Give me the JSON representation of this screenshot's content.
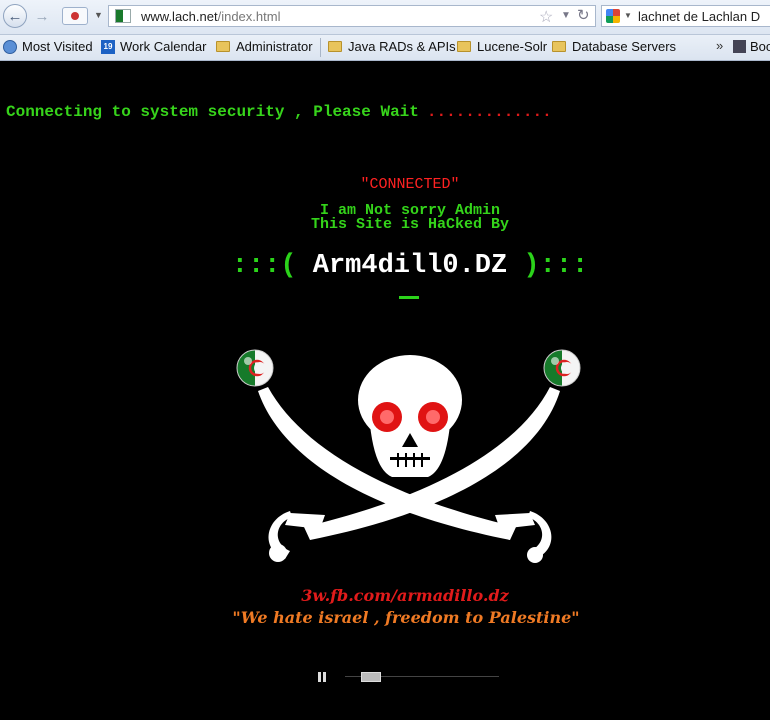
{
  "browser": {
    "url_host": "www.lach.net",
    "url_path": "/index.html",
    "search_text": "lachnet de Lachlan D",
    "bookmarks": [
      {
        "label": "Most Visited"
      },
      {
        "label": "Work Calendar",
        "icon_text": "19"
      },
      {
        "label": "Administrator"
      },
      {
        "label": "Java RADs & APIs"
      },
      {
        "label": "Lucene-Solr"
      },
      {
        "label": "Database Servers"
      },
      {
        "label": "Boo"
      }
    ],
    "more_chevron": "»"
  },
  "page": {
    "connecting_text": "Connecting to system security , Please Wait",
    "connecting_dots": ".............",
    "connected_text": "\"CONNECTED\"",
    "line1": "I am Not sorry Admin",
    "line2": "This Site is HaCked By",
    "handle_left": ":::(",
    "handle_name": " Arm4dill0.DZ ",
    "handle_right": "):::",
    "fb_link": "3w.fb.com/armadillo.dz",
    "slogan": "\"We hate israel , freedom to Palestine\""
  },
  "colors": {
    "background": "#000000",
    "green": "#37d41b",
    "red": "#e01b1b",
    "orange": "#ef7a24"
  },
  "media": {
    "progress_fraction": 0.12
  }
}
